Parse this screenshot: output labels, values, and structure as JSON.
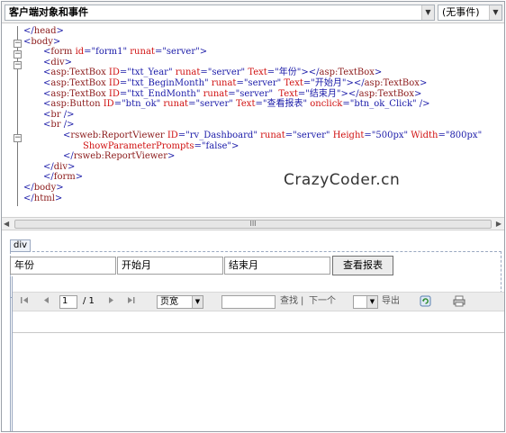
{
  "topbar": {
    "left_dropdown": "客户端对象和事件",
    "right_dropdown": "(无事件)"
  },
  "code_lines": [
    {
      "parts": [
        {
          "t": "</",
          "c": "b"
        },
        {
          "t": "head",
          "c": "m"
        },
        {
          "t": ">",
          "c": "b"
        }
      ],
      "indent": 0
    },
    {
      "parts": [
        {
          "t": "<",
          "c": "b"
        },
        {
          "t": "body",
          "c": "m"
        },
        {
          "t": ">",
          "c": "b"
        }
      ],
      "indent": 0
    },
    {
      "parts": [
        {
          "t": "<",
          "c": "b"
        },
        {
          "t": "form ",
          "c": "m"
        },
        {
          "t": "id",
          "c": "r"
        },
        {
          "t": "=\"form1\" ",
          "c": "v"
        },
        {
          "t": "runat",
          "c": "r"
        },
        {
          "t": "=\"server\">",
          "c": "v"
        }
      ],
      "indent": 2
    },
    {
      "parts": [
        {
          "t": "<",
          "c": "b"
        },
        {
          "t": "div",
          "c": "m"
        },
        {
          "t": ">",
          "c": "b"
        }
      ],
      "indent": 2
    },
    {
      "parts": [
        {
          "t": "<",
          "c": "b"
        },
        {
          "t": "asp:TextBox ",
          "c": "m"
        },
        {
          "t": "ID",
          "c": "r"
        },
        {
          "t": "=\"txt_Year\" ",
          "c": "v"
        },
        {
          "t": "runat",
          "c": "r"
        },
        {
          "t": "=\"server\" ",
          "c": "v"
        },
        {
          "t": "Text",
          "c": "r"
        },
        {
          "t": "=\"年份\">",
          "c": "v"
        },
        {
          "t": "</",
          "c": "b"
        },
        {
          "t": "asp:TextBox",
          "c": "m"
        },
        {
          "t": ">",
          "c": "b"
        }
      ],
      "indent": 2
    },
    {
      "parts": [
        {
          "t": "<",
          "c": "b"
        },
        {
          "t": "asp:TextBox ",
          "c": "m"
        },
        {
          "t": "ID",
          "c": "r"
        },
        {
          "t": "=\"txt_BeginMonth\" ",
          "c": "v"
        },
        {
          "t": "runat",
          "c": "r"
        },
        {
          "t": "=\"server\" ",
          "c": "v"
        },
        {
          "t": "Text",
          "c": "r"
        },
        {
          "t": "=\"开始月\">",
          "c": "v"
        },
        {
          "t": "</",
          "c": "b"
        },
        {
          "t": "asp:TextBox",
          "c": "m"
        },
        {
          "t": ">",
          "c": "b"
        }
      ],
      "indent": 2
    },
    {
      "parts": [
        {
          "t": "<",
          "c": "b"
        },
        {
          "t": "asp:TextBox ",
          "c": "m"
        },
        {
          "t": "ID",
          "c": "r"
        },
        {
          "t": "=\"txt_EndMonth\" ",
          "c": "v"
        },
        {
          "t": "runat",
          "c": "r"
        },
        {
          "t": "=\"server\"  ",
          "c": "v"
        },
        {
          "t": "Text",
          "c": "r"
        },
        {
          "t": "=\"结束月\">",
          "c": "v"
        },
        {
          "t": "</",
          "c": "b"
        },
        {
          "t": "asp:TextBox",
          "c": "m"
        },
        {
          "t": ">",
          "c": "b"
        }
      ],
      "indent": 2
    },
    {
      "parts": [
        {
          "t": "<",
          "c": "b"
        },
        {
          "t": "asp:Button ",
          "c": "m"
        },
        {
          "t": "ID",
          "c": "r"
        },
        {
          "t": "=\"btn_ok\" ",
          "c": "v"
        },
        {
          "t": "runat",
          "c": "r"
        },
        {
          "t": "=\"server\" ",
          "c": "v"
        },
        {
          "t": "Text",
          "c": "r"
        },
        {
          "t": "=\"查看报表\" ",
          "c": "v"
        },
        {
          "t": "onclick",
          "c": "r"
        },
        {
          "t": "=\"btn_ok_Click\" ",
          "c": "v"
        },
        {
          "t": "/>",
          "c": "b"
        }
      ],
      "indent": 2
    },
    {
      "parts": [
        {
          "t": "<",
          "c": "b"
        },
        {
          "t": "br ",
          "c": "m"
        },
        {
          "t": "/>",
          "c": "b"
        }
      ],
      "indent": 2
    },
    {
      "parts": [
        {
          "t": "<",
          "c": "b"
        },
        {
          "t": "br ",
          "c": "m"
        },
        {
          "t": "/>",
          "c": "b"
        }
      ],
      "indent": 2
    },
    {
      "parts": [
        {
          "t": "<",
          "c": "b"
        },
        {
          "t": "rsweb:ReportViewer ",
          "c": "m"
        },
        {
          "t": "ID",
          "c": "r"
        },
        {
          "t": "=\"rv_Dashboard\" ",
          "c": "v"
        },
        {
          "t": "runat",
          "c": "r"
        },
        {
          "t": "=\"server\" ",
          "c": "v"
        },
        {
          "t": "Height",
          "c": "r"
        },
        {
          "t": "=\"500px\" ",
          "c": "v"
        },
        {
          "t": "Width",
          "c": "r"
        },
        {
          "t": "=\"800px\"",
          "c": "v"
        }
      ],
      "indent": 4
    },
    {
      "parts": [
        {
          "t": "ShowParameterPrompts",
          "c": "r"
        },
        {
          "t": "=\"false\">",
          "c": "v"
        }
      ],
      "indent": 6
    },
    {
      "parts": [
        {
          "t": "</",
          "c": "b"
        },
        {
          "t": "rsweb:ReportViewer",
          "c": "m"
        },
        {
          "t": ">",
          "c": "b"
        }
      ],
      "indent": 4
    },
    {
      "parts": [
        {
          "t": "</",
          "c": "b"
        },
        {
          "t": "div",
          "c": "m"
        },
        {
          "t": ">",
          "c": "b"
        }
      ],
      "indent": 2
    },
    {
      "parts": [
        {
          "t": "</",
          "c": "b"
        },
        {
          "t": "form",
          "c": "m"
        },
        {
          "t": ">",
          "c": "b"
        }
      ],
      "indent": 2
    },
    {
      "parts": [
        {
          "t": "</",
          "c": "b"
        },
        {
          "t": "body",
          "c": "m"
        },
        {
          "t": ">",
          "c": "b"
        }
      ],
      "indent": 0
    },
    {
      "parts": [
        {
          "t": "</",
          "c": "b"
        },
        {
          "t": "html",
          "c": "m"
        },
        {
          "t": ">",
          "c": "b"
        }
      ],
      "indent": 0
    }
  ],
  "scrollbar": {
    "thumb_grip": "III"
  },
  "design": {
    "div_tag": "div",
    "textbox_year": "年份",
    "textbox_begin_month": "开始月",
    "textbox_end_month": "结束月",
    "view_report_button": "查看报表"
  },
  "report_toolbar": {
    "page_current": "1",
    "page_total": "/ 1",
    "zoom": "页宽",
    "find_label": "查找",
    "separator": "|",
    "next_label": "下一个",
    "export_label": "导出"
  },
  "watermark": "CrazyCoder.cn",
  "colors": {
    "bracket": "#1a1aa8",
    "element": "#8b1a1a",
    "attribute": "#d01010",
    "value": "#1a1aa8"
  }
}
